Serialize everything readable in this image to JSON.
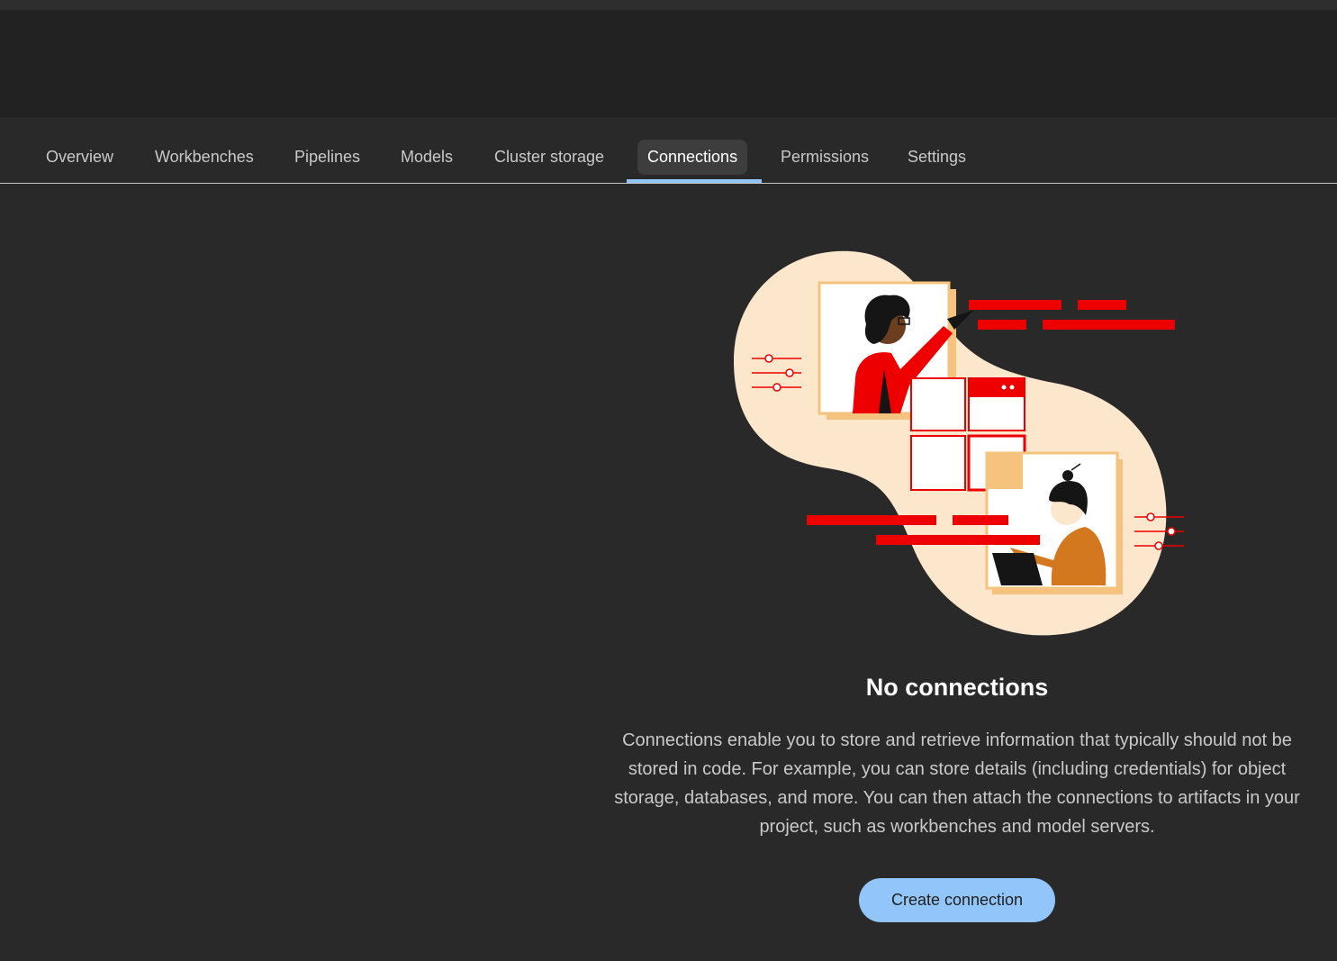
{
  "tabs": [
    {
      "label": "Overview"
    },
    {
      "label": "Workbenches"
    },
    {
      "label": "Pipelines"
    },
    {
      "label": "Models"
    },
    {
      "label": "Cluster storage"
    },
    {
      "label": "Connections",
      "active": true
    },
    {
      "label": "Permissions"
    },
    {
      "label": "Settings"
    }
  ],
  "empty_state": {
    "illustration": "collaboration-illustration",
    "title": "No connections",
    "description": "Connections enable you to store and retrieve information that typically should not be stored in code. For example, you can store details (including credentials) for object storage, databases, and more. You can then attach the connections to artifacts in your project, such as workbenches and model servers.",
    "button_label": "Create connection"
  },
  "colors": {
    "accent": "#92c5f9",
    "illustration_red": "#ee0000",
    "illustration_peach": "#fde7cc",
    "illustration_orange": "#f5c37d"
  }
}
